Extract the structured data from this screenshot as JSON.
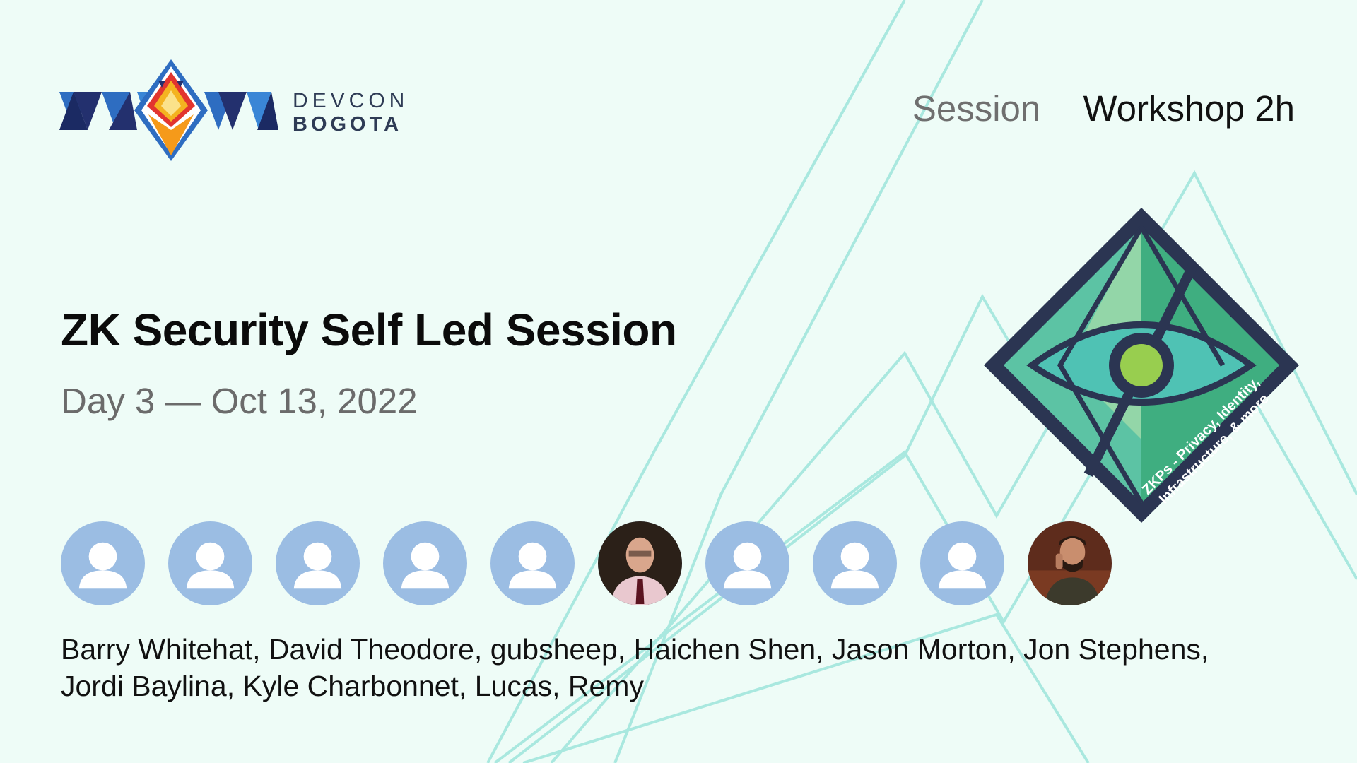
{
  "brand": {
    "logo_line1": "DEVCON",
    "logo_line2": "BOGOTA",
    "colors": {
      "navy": "#23306e",
      "blue": "#2e6dc1",
      "mint": "#eefcf7",
      "line": "#a9e8df"
    }
  },
  "header": {
    "type_label": "Session",
    "format_label": "Workshop 2h"
  },
  "session": {
    "title": "ZK Security Self Led Session",
    "date": "Day 3 — Oct 13, 2022"
  },
  "track": {
    "label_line1": "ZKPs - Privacy, Identity,",
    "label_line2": "Infrastructure, & more",
    "icon": "eye-diamond-icon"
  },
  "speakers": {
    "avatars": [
      {
        "kind": "placeholder"
      },
      {
        "kind": "placeholder"
      },
      {
        "kind": "placeholder"
      },
      {
        "kind": "placeholder"
      },
      {
        "kind": "placeholder"
      },
      {
        "kind": "photo"
      },
      {
        "kind": "placeholder"
      },
      {
        "kind": "placeholder"
      },
      {
        "kind": "placeholder"
      },
      {
        "kind": "photo"
      }
    ],
    "names_text": "Barry Whitehat, David Theodore, gubsheep, Haichen Shen, Jason Morton, Jon Stephens, Jordi Baylina, Kyle Charbonnet, Lucas, Remy"
  }
}
